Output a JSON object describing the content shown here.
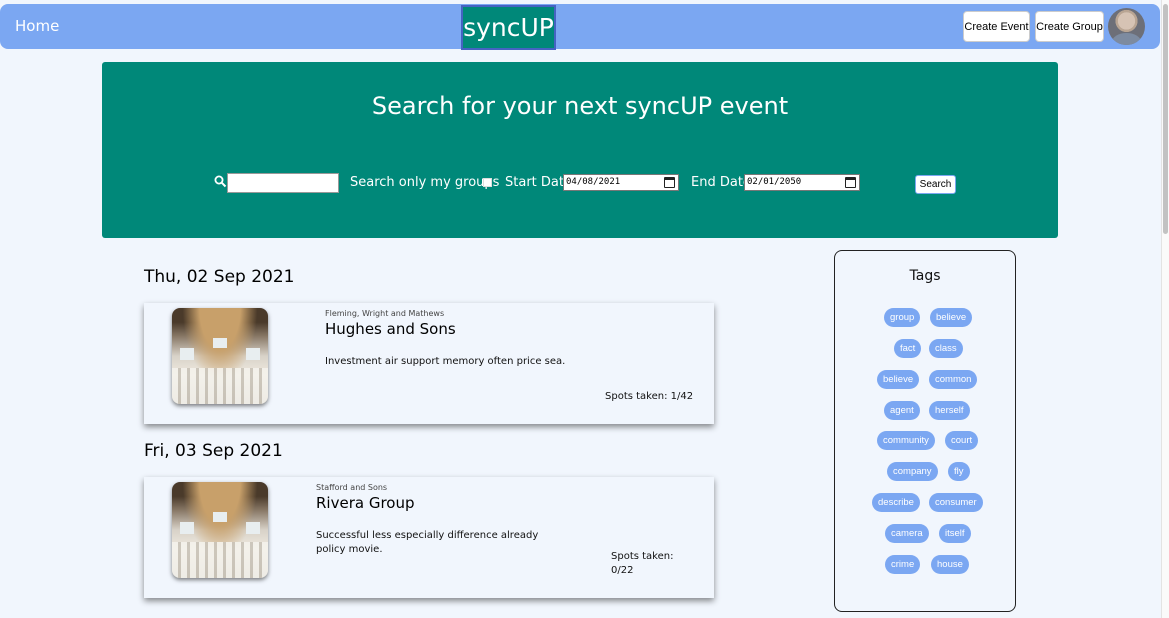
{
  "nav": {
    "home_label": "Home",
    "logo_text": "syncUP",
    "create_event_label": "Create Event",
    "create_group_label": "Create Group"
  },
  "hero": {
    "title": "Search for your next syncUP event",
    "search_value": "",
    "only_my_groups_label": "Search only my groups",
    "only_my_groups_checked": false,
    "start_date_label": "Start Date",
    "start_date_value": "04/08/2021",
    "end_date_label": "End Date",
    "end_date_value": "02/01/2050",
    "search_button_label": "Search"
  },
  "events": [
    {
      "date": "Thu, 02 Sep 2021",
      "group": "Fleming, Wright and Mathews",
      "title": "Hughes and Sons",
      "description": "Investment air support memory often price sea.",
      "spots": "Spots taken: 1/42"
    },
    {
      "date": "Fri, 03 Sep 2021",
      "group": "Stafford and Sons",
      "title": "Rivera Group",
      "description": "Successful less especially difference already policy movie.",
      "spots": "Spots taken: 0/22"
    }
  ],
  "tags": {
    "title": "Tags",
    "items": [
      "group",
      "believe",
      "fact",
      "class",
      "believe",
      "common",
      "agent",
      "herself",
      "community",
      "court",
      "company",
      "fly",
      "describe",
      "consumer",
      "camera",
      "itself",
      "crime",
      "house"
    ]
  },
  "colors": {
    "nav_bg": "#7ba7f2",
    "hero_bg": "#008879",
    "page_bg": "#f1f6fd",
    "tag_bg": "#7ba7f2"
  }
}
